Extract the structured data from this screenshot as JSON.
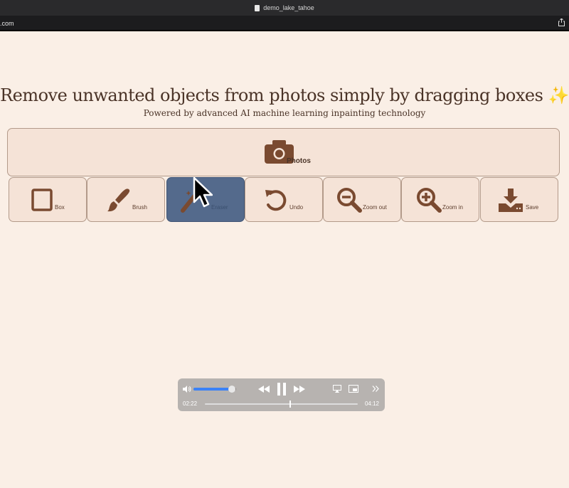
{
  "window": {
    "title": "demo_lake_tahoe",
    "url": ".com"
  },
  "page": {
    "title": "Remove unwanted objects from photos simply by dragging boxes ✨",
    "subtitle": "Powered by advanced AI machine learning inpainting technology"
  },
  "photos_button": {
    "label": "Photos",
    "icon": "camera-icon"
  },
  "toolbar": {
    "tools": [
      {
        "label": "Box",
        "icon": "square-icon"
      },
      {
        "label": "Brush",
        "icon": "brush-icon"
      },
      {
        "label": "Eraser",
        "icon": "magic-wand-icon",
        "active": true
      },
      {
        "label": "Undo",
        "icon": "undo-icon"
      },
      {
        "label": "Zoom out",
        "icon": "zoom-out-icon"
      },
      {
        "label": "Zoom in",
        "icon": "zoom-in-icon"
      },
      {
        "label": "Save",
        "icon": "download-icon"
      }
    ]
  },
  "video_controls": {
    "current_time": "02:22",
    "duration": "04:12",
    "volume": 0.9,
    "progress": 0.56
  },
  "colors": {
    "background": "#faefe6",
    "button_fill": "#f5e3d7",
    "button_border": "#b39a8a",
    "icon": "#7a4a30",
    "active_tool": "#546a8c",
    "volume_accent": "#3b82f6"
  }
}
